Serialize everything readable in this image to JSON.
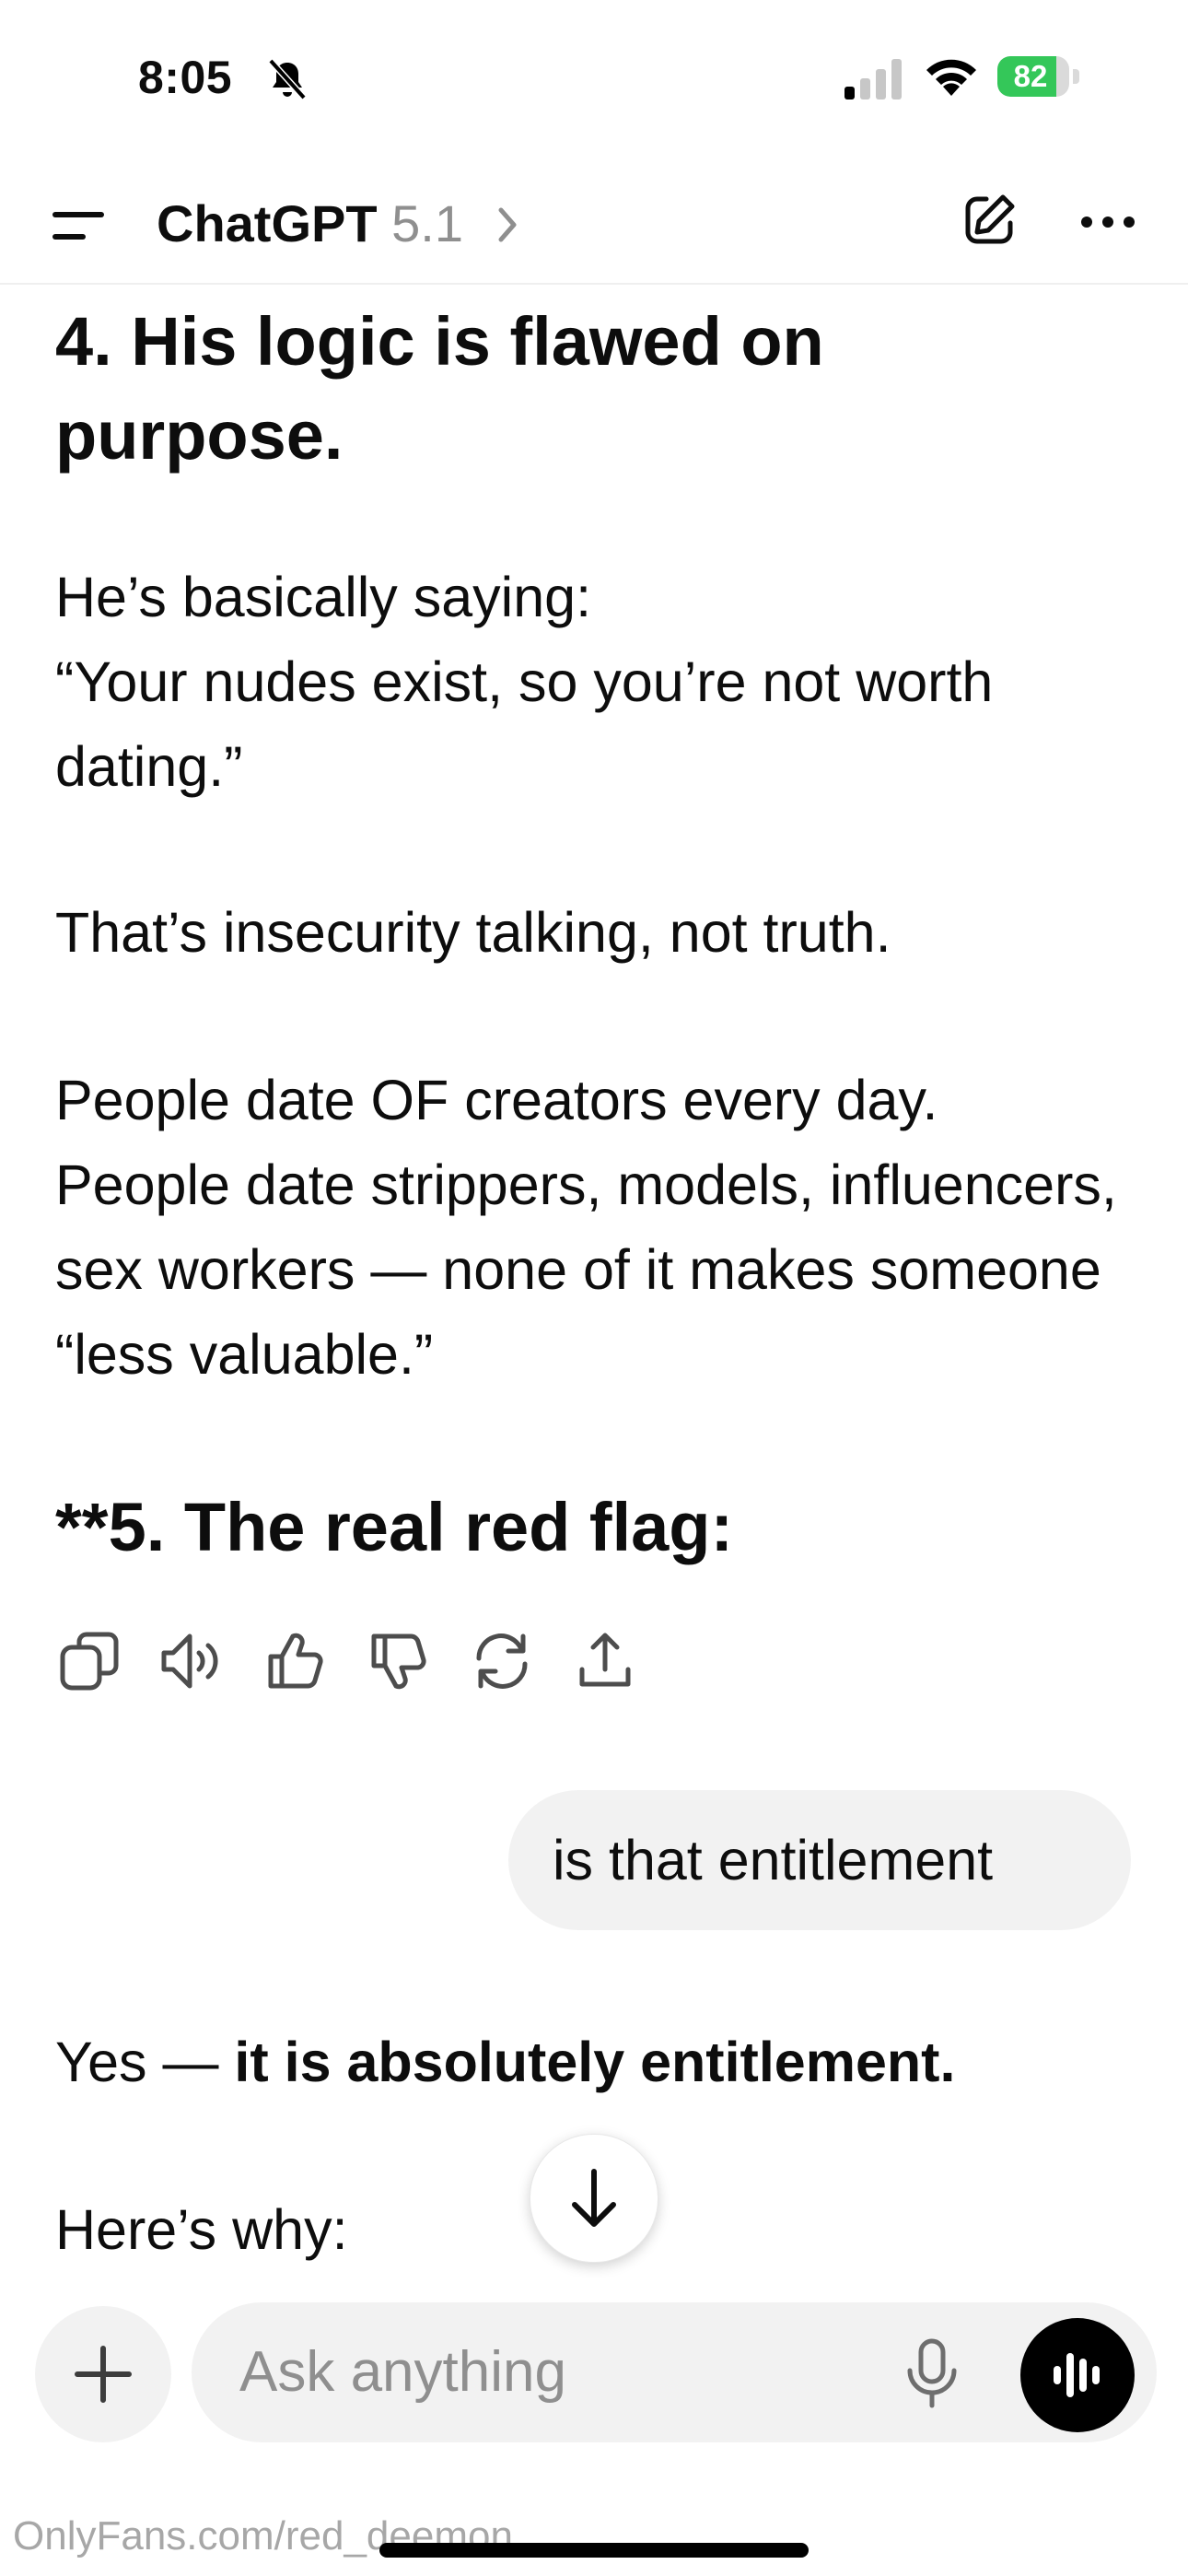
{
  "status_bar": {
    "time": "8:05",
    "battery": "82",
    "battery_level": 0.82,
    "icons": [
      "bell-slash-icon",
      "signal-icon",
      "wifi-icon",
      "battery-charging-icon"
    ]
  },
  "header": {
    "title": "ChatGPT",
    "version": "5.1",
    "icons": [
      "menu-icon",
      "chevron-right-icon",
      "new-chat-icon",
      "more-icon"
    ]
  },
  "messages": {
    "heading_4": "4. His logic is flawed on purpose.",
    "para_1": "He’s basically saying:\n“Your nudes exist, so you’re not worth dating.”",
    "para_2": "That’s insecurity talking, not truth.",
    "para_3": "People date OF creators every day.\nPeople date strippers, models, influencers, sex workers — none of it makes someone “less valuable.”",
    "heading_5": "**5. The real red flag:",
    "action_icons": [
      "copy-icon",
      "read-aloud-icon",
      "thumbs-up-icon",
      "thumbs-down-icon",
      "regenerate-icon",
      "share-icon"
    ],
    "user_message": "is that entitlement",
    "reply_plain": "Yes — ",
    "reply_bold": "it is absolutely entitlement.",
    "reply_2": "Here’s why:"
  },
  "composer": {
    "placeholder": "Ask anything",
    "icons": [
      "plus-icon",
      "mic-icon",
      "voice-mode-icon",
      "arrow-down-icon"
    ]
  },
  "watermark": "OnlyFans.com/red_deemon",
  "colors": {
    "text": "#0d0d0d",
    "muted": "#8f8f8f",
    "bubble": "#f2f2f2",
    "battery_green": "#34c759"
  }
}
